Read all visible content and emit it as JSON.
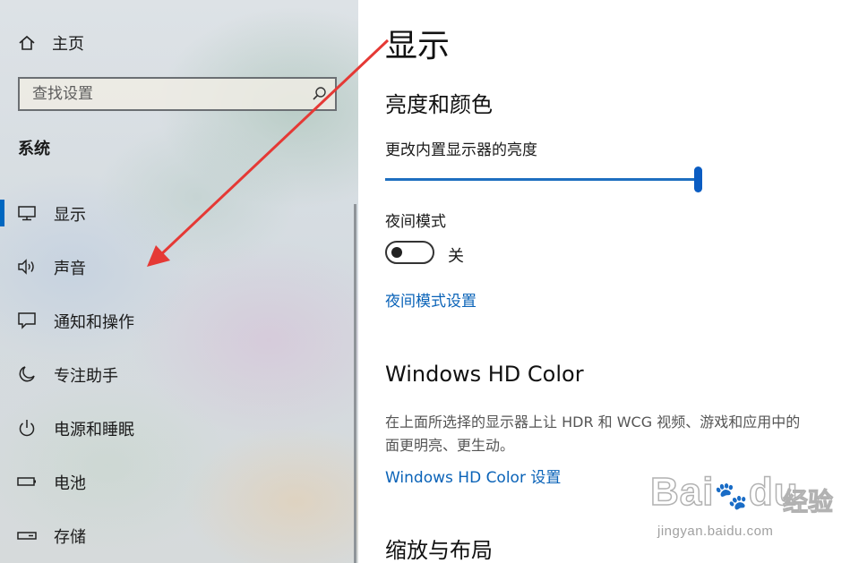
{
  "sidebar": {
    "home_label": "主页",
    "search_placeholder": "查找设置",
    "section_title": "系统",
    "items": [
      {
        "label": "显示",
        "icon": "monitor-icon",
        "active": true
      },
      {
        "label": "声音",
        "icon": "speaker-icon"
      },
      {
        "label": "通知和操作",
        "icon": "notification-icon"
      },
      {
        "label": "专注助手",
        "icon": "moon-icon"
      },
      {
        "label": "电源和睡眠",
        "icon": "power-icon"
      },
      {
        "label": "电池",
        "icon": "battery-icon"
      },
      {
        "label": "存储",
        "icon": "storage-icon"
      }
    ]
  },
  "main": {
    "title": "显示",
    "brightness_section": "亮度和颜色",
    "brightness_label": "更改内置显示器的亮度",
    "brightness_value": 100,
    "night_mode_label": "夜间模式",
    "night_mode_state": "关",
    "night_mode_link": "夜间模式设置",
    "hd_color_title": "Windows HD Color",
    "hd_color_desc_line1": "在上面所选择的显示器上让 HDR 和 WCG 视频、游戏和应用中的",
    "hd_color_desc_line2": "面更明亮、更生动。",
    "hd_color_link": "Windows HD Color 设置",
    "scale_section": "缩放与布局"
  },
  "watermark": {
    "brand": "Bai",
    "brand2": "du",
    "product": "经验",
    "url": "jingyan.baidu.com"
  },
  "colors": {
    "accent": "#0067c0",
    "link": "#0a63b8",
    "annotation_arrow": "#e53935"
  }
}
